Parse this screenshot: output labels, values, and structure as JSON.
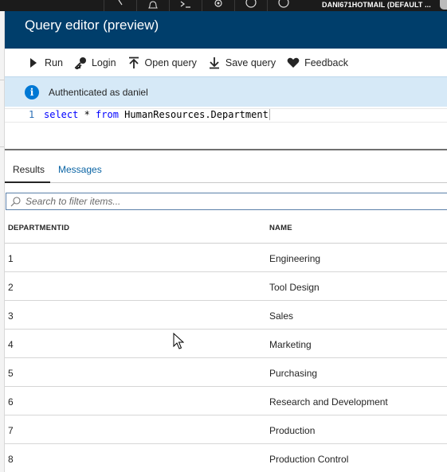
{
  "topbar": {
    "account": "DANI671HOTMAIL (DEFAULT ...",
    "icons": [
      "chevron-icon",
      "bell-icon",
      "cloud-shell-icon",
      "settings-icon",
      "smiley-icon",
      "help-icon"
    ]
  },
  "blade": {
    "title": "Query editor (preview)"
  },
  "toolbar": {
    "run": "Run",
    "login": "Login",
    "open_query": "Open query",
    "save_query": "Save query",
    "feedback": "Feedback"
  },
  "banner": {
    "text": "Authenticated as daniel"
  },
  "editor": {
    "line_number": "1",
    "keyword_select": "select",
    "star": " * ",
    "keyword_from": "from",
    "object": " HumanResources.Department"
  },
  "results": {
    "tabs": {
      "results": "Results",
      "messages": "Messages"
    },
    "filter_placeholder": "Search to filter items...",
    "columns": {
      "id": "DEPARTMENTID",
      "name": "NAME"
    },
    "rows": [
      {
        "id": "1",
        "name": "Engineering"
      },
      {
        "id": "2",
        "name": "Tool Design"
      },
      {
        "id": "3",
        "name": "Sales"
      },
      {
        "id": "4",
        "name": "Marketing"
      },
      {
        "id": "5",
        "name": "Purchasing"
      },
      {
        "id": "6",
        "name": "Research and Development"
      },
      {
        "id": "7",
        "name": "Production"
      },
      {
        "id": "8",
        "name": "Production Control"
      }
    ]
  },
  "colors": {
    "header_bg": "#003e6b",
    "banner_bg": "#d6e9f7",
    "accent": "#0078d4",
    "keyword": "#0000ff"
  }
}
